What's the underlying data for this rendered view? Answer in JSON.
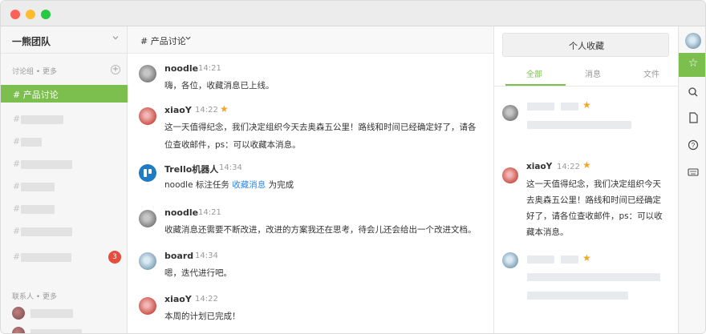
{
  "sidebar": {
    "team_name": "一熊团队",
    "groups_label": "讨论组 • 更多",
    "active_channel": "# 产品讨论",
    "channel_hash": "#",
    "unread_badge": "3",
    "contacts_label": "联系人 • 更多"
  },
  "chat": {
    "title": "# 产品讨论",
    "messages": [
      {
        "name": "noodle",
        "time": "14:21",
        "text": "嗨，各位，收藏消息已上线。"
      },
      {
        "name": "xiaoY",
        "time": "14:22",
        "starred": true,
        "text_line1": "这一天值得纪念，我们决定组织今天去奥森五公里！路线和时间已经确定好了，请各",
        "text_line2": "位查收邮件，ps：可以收藏本消息。"
      },
      {
        "name": "Trello机器人",
        "time": "14:34",
        "text_pre": "noodle 标注任务 ",
        "text_link": "收藏消息",
        "text_post": " 为完成"
      },
      {
        "name": "noodle",
        "time": "14:21",
        "text": "收藏消息还需要不断改进，改进的方案我还在思考，待会儿还会给出一个改进文档。"
      },
      {
        "name": "board",
        "time": "14:34",
        "text": "嗯，迭代进行吧。"
      },
      {
        "name": "xiaoY",
        "time": "14:22",
        "text": "本周的计划已完成！"
      }
    ]
  },
  "panel": {
    "title": "个人收藏",
    "tabs": [
      "全部",
      "消息",
      "文件"
    ],
    "active_tab": "全部",
    "item": {
      "name": "xiaoY",
      "time": "14:22",
      "lines": [
        "这一天值得纪念，我们决定组织今天",
        "去奥森五公里！路线和时间已经确定",
        "好了，请各位查收邮件，ps：可以收",
        "藏本消息。"
      ]
    }
  },
  "colors": {
    "accent": "#7dbf4f",
    "star": "#f5a623",
    "badge": "#e74c3c",
    "link": "#2e86de"
  },
  "toolbar": {
    "icons": [
      "avatar",
      "star-icon",
      "search-icon",
      "file-icon",
      "help-icon",
      "keyboard-icon"
    ]
  }
}
